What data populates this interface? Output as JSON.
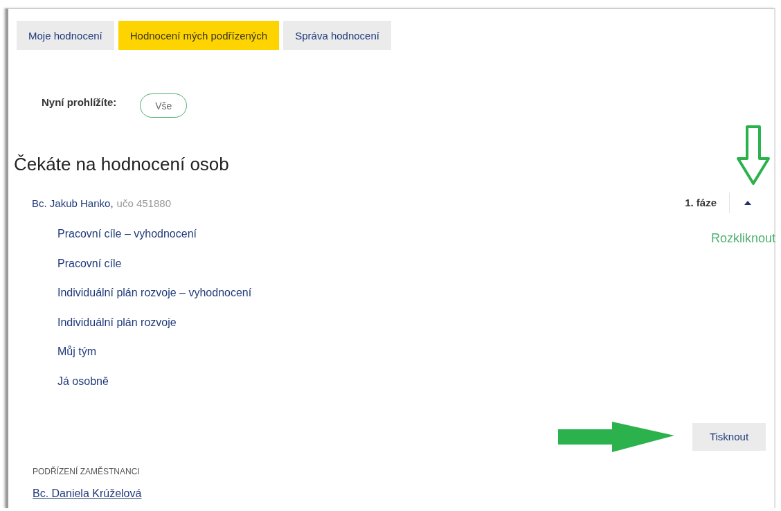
{
  "tabs": [
    {
      "label": "Moje hodnocení",
      "selected": false
    },
    {
      "label": "Hodnocení mých podřízených",
      "selected": true
    },
    {
      "label": "Správa hodnocení",
      "selected": false
    }
  ],
  "filter": {
    "label": "Nyní prohlížíte:",
    "value": "Vše"
  },
  "heading": "Čekáte na hodnocení osob",
  "person": {
    "name": "Bc. Jakub Hanko,",
    "uco": "učo 451880",
    "phase": "1. fáze",
    "expanded": true,
    "items": [
      "Pracovní cíle – vyhodnocení",
      "Pracovní cíle",
      "Individuální plán rozvoje – vyhodnocení",
      "Individuální plán rozvoje",
      "Můj tým",
      "Já osobně"
    ]
  },
  "annotation": {
    "label": "Rozkliknout"
  },
  "print_button": "Tisknout",
  "subordinates": {
    "title": "PODŘÍZENÍ ZAMĚSTNANCI",
    "people": [
      "Bc. Daniela Krúželová"
    ]
  }
}
